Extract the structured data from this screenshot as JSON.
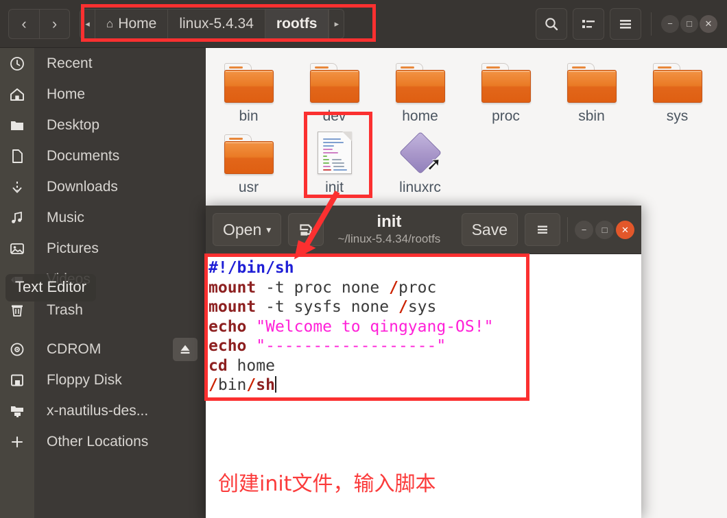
{
  "filemanager": {
    "nav": {
      "back": "‹",
      "forward": "›"
    },
    "breadcrumb": {
      "left_arrow": "◂",
      "right_arrow": "▸",
      "items": [
        {
          "label": "Home",
          "icon": "home-icon",
          "current": false
        },
        {
          "label": "linux-5.4.34",
          "icon": "",
          "current": false
        },
        {
          "label": "rootfs",
          "icon": "",
          "current": true
        }
      ]
    },
    "toolbar": {
      "search": "search-icon",
      "view_list": "list-view-icon",
      "menu": "hamburger-menu-icon"
    },
    "window_controls": {
      "minimize": "−",
      "maximize": "□",
      "close": "✕"
    },
    "sidebar": {
      "items": [
        {
          "label": "Recent",
          "icon": "clock-icon",
          "eject": false
        },
        {
          "label": "Home",
          "icon": "home-icon",
          "eject": false
        },
        {
          "label": "Desktop",
          "icon": "folder-icon",
          "eject": false
        },
        {
          "label": "Documents",
          "icon": "document-icon",
          "eject": false
        },
        {
          "label": "Downloads",
          "icon": "download-icon",
          "eject": false
        },
        {
          "label": "Music",
          "icon": "music-icon",
          "eject": false
        },
        {
          "label": "Pictures",
          "icon": "picture-icon",
          "eject": false
        },
        {
          "label": "Videos",
          "icon": "video-icon",
          "eject": false
        },
        {
          "label": "Trash",
          "icon": "trash-icon",
          "eject": false
        },
        {
          "label": "CDROM",
          "icon": "disc-icon",
          "eject": true
        },
        {
          "label": "Floppy Disk",
          "icon": "floppy-icon",
          "eject": false
        },
        {
          "label": "x-nautilus-des...",
          "icon": "network-folder-icon",
          "eject": false
        },
        {
          "label": "Other Locations",
          "icon": "plus-icon",
          "eject": false
        }
      ],
      "tooltip": "Text Editor",
      "eject_glyph": "⏏"
    },
    "files": [
      {
        "name": "bin",
        "type": "folder"
      },
      {
        "name": "dev",
        "type": "folder"
      },
      {
        "name": "home",
        "type": "folder"
      },
      {
        "name": "proc",
        "type": "folder"
      },
      {
        "name": "sbin",
        "type": "folder"
      },
      {
        "name": "sys",
        "type": "folder"
      },
      {
        "name": "usr",
        "type": "folder"
      },
      {
        "name": "init",
        "type": "document"
      },
      {
        "name": "linuxrc",
        "type": "symlink"
      }
    ]
  },
  "editor": {
    "open_label": "Open",
    "open_caret": "▾",
    "save_as_icon": "save-as-icon",
    "title": "init",
    "subtitle": "~/linux-5.4.34/rootfs",
    "save_label": "Save",
    "menu_icon": "hamburger-menu-icon",
    "window_controls": {
      "minimize": "−",
      "maximize": "□",
      "close": "✕"
    },
    "code_lines": [
      [
        {
          "t": "#!/bin/sh",
          "c": "tk-b"
        }
      ],
      [
        {
          "t": "mount",
          "c": "tk-cmd"
        },
        {
          "t": " -t proc none ",
          "c": "tk-plain"
        },
        {
          "t": "/",
          "c": "tk-sl"
        },
        {
          "t": "proc",
          "c": "tk-plain"
        }
      ],
      [
        {
          "t": "mount",
          "c": "tk-cmd"
        },
        {
          "t": " -t sysfs none ",
          "c": "tk-plain"
        },
        {
          "t": "/",
          "c": "tk-sl"
        },
        {
          "t": "sys",
          "c": "tk-plain"
        }
      ],
      [
        {
          "t": "echo",
          "c": "tk-cmd"
        },
        {
          "t": " ",
          "c": "tk-plain"
        },
        {
          "t": "\"Welcome to qingyang-OS!\"",
          "c": "tk-str"
        }
      ],
      [
        {
          "t": "echo",
          "c": "tk-cmd"
        },
        {
          "t": " ",
          "c": "tk-plain"
        },
        {
          "t": "\"------------------\"",
          "c": "tk-str"
        }
      ],
      [
        {
          "t": "cd",
          "c": "tk-cmd"
        },
        {
          "t": " home",
          "c": "tk-plain"
        }
      ],
      [
        {
          "t": "/",
          "c": "tk-sl"
        },
        {
          "t": "bin",
          "c": "tk-plain"
        },
        {
          "t": "/",
          "c": "tk-sl"
        },
        {
          "t": "sh",
          "c": "tk-cmd"
        }
      ]
    ],
    "annotation_note": "创建init文件，输入脚本"
  },
  "annotations": {
    "highlight_color": "#fb3030",
    "boxes": [
      {
        "name": "breadcrumb-highlight"
      },
      {
        "name": "init-file-highlight"
      },
      {
        "name": "code-highlight"
      }
    ],
    "arrow": {
      "name": "pointer-arrow",
      "from": "init file icon",
      "to": "editor text area"
    }
  }
}
